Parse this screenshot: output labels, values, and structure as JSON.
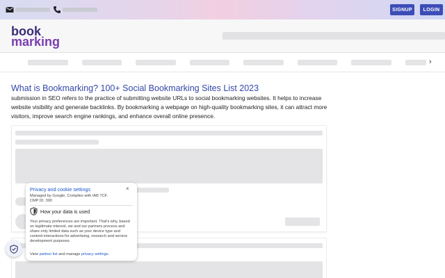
{
  "topbar": {
    "email_icon": "envelope-icon",
    "phone_icon": "phone-icon",
    "signup_label": "SIGNUP",
    "login_label": "LOGIN"
  },
  "logo": {
    "line1": "book",
    "line2": "marking"
  },
  "nav": {
    "next_icon": "chevron-right-icon",
    "next_glyph": "›"
  },
  "article": {
    "title": "What is Bookmarking? 100+ Social Bookmarking Sites List 2023",
    "description": "submission in SEO refers to the practice of submitting website URLs to social bookmarking websites. It helps to increase website visibility and generate backlinks. By bookmarking a webpage on high-quality bookmarking sites, it can attract more visitors, improve search engine rankings, and enhance overall online presence."
  },
  "cookie": {
    "title": "Privacy and cookie settings",
    "close_glyph": "×",
    "managed_by": "Managed by Google. Complies with IAB TCF.",
    "cmp_id": "CMP ID: 300",
    "heading": "How your data is used",
    "body": "Your privacy preferences are important. That's why, based on legitimate interest, we and our partners process and share only limited data such as your device type and content interactions for advertising, research and service development purposes.",
    "footer_prefix": "View ",
    "partner_link": "partner list",
    "footer_mid": " and manage ",
    "privacy_link": "privacy settings",
    "footer_suffix": "."
  },
  "colors": {
    "accent": "#3d4db7",
    "title_blue": "#3448a8",
    "logo_dark": "#3b2c78",
    "logo_purple": "#7a3db0",
    "link_blue": "#1a56c8"
  }
}
